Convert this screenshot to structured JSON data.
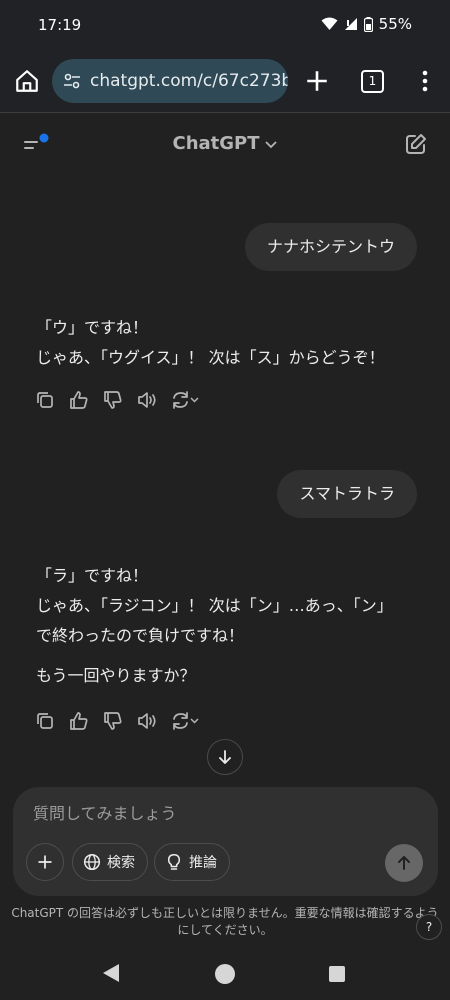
{
  "status": {
    "time": "17:19",
    "battery": "55%"
  },
  "browser": {
    "url": "chatgpt.com/c/67c273bf",
    "tab_count": "1"
  },
  "header": {
    "title": "ChatGPT"
  },
  "messages": [
    {
      "role": "user",
      "text": "ナナホシテントウ"
    },
    {
      "role": "assistant",
      "paragraphs": [
        "「ウ」ですね！",
        "じゃあ、「ウグイス」！ 次は「ス」からどうぞ！"
      ]
    },
    {
      "role": "user",
      "text": "スマトラトラ"
    },
    {
      "role": "assistant",
      "paragraphs": [
        "「ラ」ですね！",
        "じゃあ、「ラジコン」！ 次は「ン」…あっ、「ン」",
        "で終わったので負けですね！",
        "もう一回やりますか？"
      ]
    }
  ],
  "composer": {
    "placeholder": "質問してみましょう",
    "search_label": "検索",
    "reason_label": "推論"
  },
  "disclaimer": "ChatGPT の回答は必ずしも正しいとは限りません。重要な情報は確認するようにしてください。",
  "help": "?",
  "colors": {
    "background": "#212121",
    "bubble": "#303030",
    "url_bar": "#2f4a56",
    "notification_dot": "#1a73e8"
  }
}
